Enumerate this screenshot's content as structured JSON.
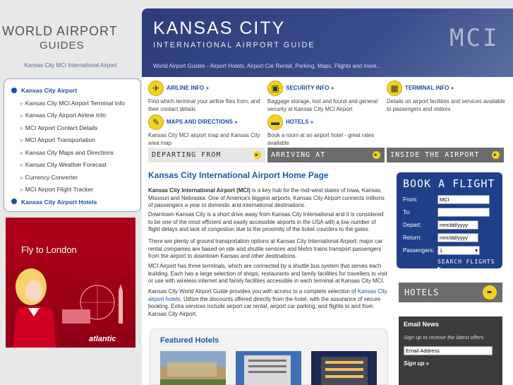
{
  "logo": {
    "line1": "WORLD AIRPORT",
    "line2": "GUIDES"
  },
  "tagline": "Kansas City MCI International Airport",
  "leftnav": [
    {
      "label": "Kansas City Airport",
      "kind": "main"
    },
    {
      "label": "Kansas City MCI Airport Terminal Info",
      "kind": "sub"
    },
    {
      "label": "Kansas City Airport Airline Info",
      "kind": "sub"
    },
    {
      "label": "MCI Airport Contact Details",
      "kind": "sub"
    },
    {
      "label": "MCI Airport Transportation",
      "kind": "sub"
    },
    {
      "label": "Kansas City Maps and Directions",
      "kind": "sub"
    },
    {
      "label": "Kansas City Weather Forecast",
      "kind": "sub"
    },
    {
      "label": "Currency Converter",
      "kind": "sub"
    },
    {
      "label": "MCI Airport Flight Tracker",
      "kind": "sub"
    },
    {
      "label": "Kansas City Airport Hotels",
      "kind": "main"
    }
  ],
  "ad": {
    "headline": "Fly to London",
    "brand": "atlantic"
  },
  "header": {
    "title": "KANSAS CITY",
    "subtitle": "INTERNATIONAL AIRPORT GUIDE",
    "nav": "World Airport Guides - Airport Hotels, Airport Car Rental, Parking, Maps, Flights and more...",
    "code": "MCI"
  },
  "features": [
    {
      "title": "AIRLINE INFO »",
      "desc": "Find which terminal your airline flies from, and their contact details",
      "icon": "airplane-icon"
    },
    {
      "title": "SECURITY INFO »",
      "desc": "Baggage storage, lost and found and general security at Kansas City MCI Airport",
      "icon": "luggage-icon"
    },
    {
      "title": "TERMINAL INFO »",
      "desc": "Details on airport facilities and services available to passengers and visitors",
      "icon": "terminal-icon"
    },
    {
      "title": "MAPS AND DIRECTIONS »",
      "desc": "Kansas City MCI airport map and Kansas City area map",
      "icon": "compass-icon"
    },
    {
      "title": "HOTELS »",
      "desc": "Book a room at an airport hotel - great rates available",
      "icon": "bed-icon"
    }
  ],
  "tabs": {
    "departing": "DEPARTING FROM",
    "arriving": "ARRIVING AT",
    "inside": "INSIDE THE AIRPORT"
  },
  "home_title": "Kansas City International Airport Home Page",
  "paragraphs": {
    "p1_bold": "Kansas City International Airport (MCI)",
    "p1": " is a key hub for the mid-west states of Iowa, Kansas, Missouri and Nebraska. One of America's biggest airports, Kansas City Airport connects millions of passengers a year to domestic and international destinations.",
    "p2": "Downtown Kansas City is a short drive away from Kansas City International and it is considered to be one of the most efficient and easily accessible airports in the USA with a low number of flight delays and lack of congestion due to the proximity of the ticket counters to the gates.",
    "p3": "There are plenty of ground transportation options at Kansas City International Airport; major car rental companies are based on site and shuttle services and Metro trains transport passengers from the airport to downtown Kansas and other destinations.",
    "p4": "MCI Airport has three terminals, which are connected by a shuttle bus system that serves each building. Each has a large selection of shops, restaurants and family facilities for travellers to visit or use with wireless internet and family facilities accessible in each terminal at Kansas City MCI.",
    "p5_a": "Kansas City World Airport Guide provides you with access to a complete selection of ",
    "p5_link": "Kansas City airport hotels",
    "p5_b": ". Utilize the discounts offered directly from the hotel, with the assurance of secure booking. Extra services include airport car rental, airport car parking, and flights to and from Kansas City Airport."
  },
  "featured_hotels": {
    "title": "Featured Hotels"
  },
  "book": {
    "title": "BOOK A FLIGHT",
    "from_label": "From:",
    "from_value": "MCI",
    "to_label": "To:",
    "to_value": "",
    "depart_label": "Depart:",
    "depart_value": "mm/dd/yyyy",
    "return_label": "Return:",
    "return_value": "mm/dd/yyyy",
    "passengers_label": "Passengers:",
    "passengers_value": "1",
    "search": "SEARCH FLIGHTS"
  },
  "hotels_box": "HOTELS",
  "email": {
    "title": "Email News",
    "subtitle": "Sign up to receive the latest offers",
    "input": "Email Address",
    "signup": "Sign up »"
  },
  "colors": {
    "brand_blue": "#1c4ea0",
    "header_navy": "#2b3c78",
    "accent_yellow": "#f2d21d",
    "ad_red": "#b0001a"
  }
}
